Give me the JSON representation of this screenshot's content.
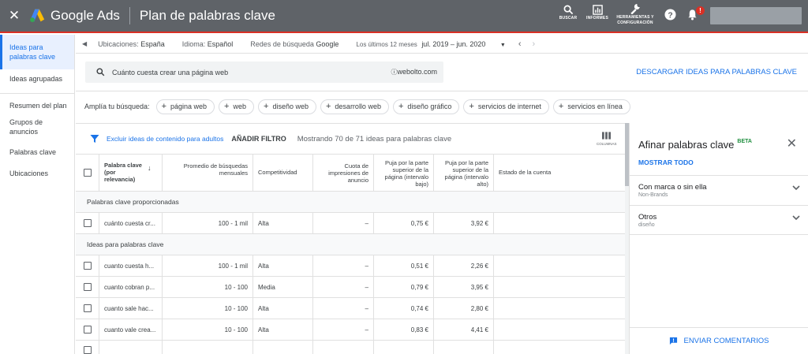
{
  "header": {
    "close_icon": "close-icon",
    "brand": "Google Ads",
    "title": "Plan de palabras clave",
    "tools": [
      {
        "icon": "search-icon",
        "label": "BUSCAR"
      },
      {
        "icon": "reports-icon",
        "label": "INFORMES"
      },
      {
        "icon": "wrench-icon",
        "label": "HERRAMIENTAS Y CONFIGURACIÓN"
      }
    ],
    "notification_badge": "!",
    "colors": {
      "bar": "#5f6368",
      "accent_line": "#d93025"
    }
  },
  "sidebar": {
    "items": [
      {
        "label": "Ideas para palabras clave",
        "active": true
      },
      {
        "label": "Ideas agrupadas",
        "active": false
      },
      {
        "label": "Resumen del plan",
        "active": false
      },
      {
        "label": "Grupos de anuncios",
        "active": false
      },
      {
        "label": "Palabras clave",
        "active": false
      },
      {
        "label": "Ubicaciones",
        "active": false
      }
    ]
  },
  "filters": {
    "locations_label": "Ubicaciones:",
    "locations_value": "España",
    "language_label": "Idioma:",
    "language_value": "Español",
    "network_label": "Redes de búsqueda",
    "network_value": "Google",
    "period_label": "Los últimos 12 meses",
    "period_value": "jul. 2019 – jun. 2020"
  },
  "search": {
    "query": "Cuánto cuesta crear una página web",
    "site": "webolto.com",
    "download_label": "DESCARGAR IDEAS PARA PALABRAS CLAVE"
  },
  "broaden": {
    "label": "Amplía tu búsqueda:",
    "chips": [
      "página web",
      "web",
      "diseño web",
      "desarrollo web",
      "diseño gráfico",
      "servicios de internet",
      "servicios en línea"
    ]
  },
  "table": {
    "adult_filter_label": "Excluir ideas de contenido para adultos",
    "add_filter_label": "AÑADIR FILTRO",
    "showing_text": "Mostrando 70 de 71 ideas para palabras clave",
    "columns_label": "COLUMNAS",
    "headers": {
      "keyword": "Palabra clave (por relevancia)",
      "avg_searches": "Promedio de búsquedas mensuales",
      "competition": "Competitividad",
      "impression_share": "Cuota de impresiones de anuncio",
      "bid_low": "Puja por la parte superior de la página (intervalo bajo)",
      "bid_high": "Puja por la parte superior de la página (intervalo alto)",
      "account_status": "Estado de la cuenta"
    },
    "section_provided": "Palabras clave proporcionadas",
    "provided_rows": [
      {
        "keyword": "cuánto cuesta cr...",
        "searches": "100 - 1 mil",
        "competition": "Alta",
        "impr": "–",
        "low": "0,75 €",
        "high": "3,92 €"
      }
    ],
    "section_ideas": "Ideas para palabras clave",
    "idea_rows": [
      {
        "keyword": "cuanto cuesta h...",
        "searches": "100 - 1 mil",
        "competition": "Alta",
        "impr": "–",
        "low": "0,51 €",
        "high": "2,26 €"
      },
      {
        "keyword": "cuanto cobran p...",
        "searches": "10 - 100",
        "competition": "Media",
        "impr": "–",
        "low": "0,79 €",
        "high": "3,95 €"
      },
      {
        "keyword": "cuanto sale hac...",
        "searches": "10 - 100",
        "competition": "Alta",
        "impr": "–",
        "low": "0,74 €",
        "high": "2,80 €"
      },
      {
        "keyword": "cuanto vale crea...",
        "searches": "10 - 100",
        "competition": "Alta",
        "impr": "–",
        "low": "0,83 €",
        "high": "4,41 €"
      }
    ]
  },
  "refine": {
    "title": "Afinar palabras clave",
    "beta": "BETA",
    "show_all": "MOSTRAR TODO",
    "groups": [
      {
        "title": "Con marca o sin ella",
        "sub": "Non-Brands"
      },
      {
        "title": "Otros",
        "sub": "diseño"
      }
    ],
    "feedback": "ENVIAR COMENTARIOS"
  }
}
